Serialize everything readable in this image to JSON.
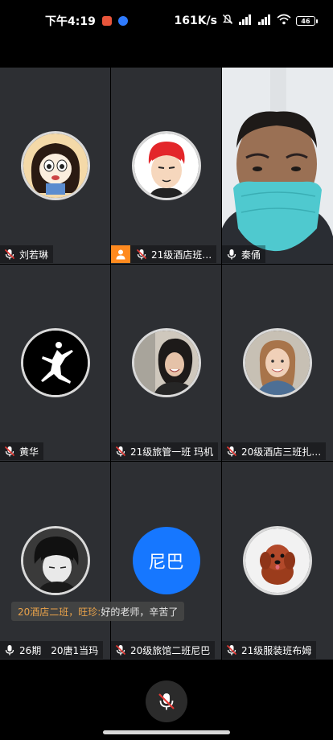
{
  "status_bar": {
    "time": "下午4:19",
    "network_speed": "161K/s",
    "battery_level": "46",
    "icons": [
      "notification-app-icon",
      "message-app-icon",
      "mute-icon",
      "signal-icon",
      "signal-icon",
      "wifi-icon",
      "battery-icon"
    ]
  },
  "participants": [
    {
      "name": "刘若琳",
      "mic": "muted",
      "avatar": "cartoon-girl"
    },
    {
      "name": "21级酒店班…",
      "mic": "muted",
      "avatar": "red-hair-anime",
      "host": true
    },
    {
      "name": "秦俑",
      "mic": "on",
      "video": "camera-feed",
      "active_speaker": true
    },
    {
      "name": "黄华",
      "mic": "muted",
      "avatar": "jumpman-logo"
    },
    {
      "name": "21级旅管一班 玛机",
      "mic": "muted",
      "avatar": "photo-woman-laughing"
    },
    {
      "name": "20级酒店三班扎…",
      "mic": "muted",
      "avatar": "photo-girl-smiling"
    },
    {
      "name": "26期　20唐1当玛",
      "mic": "on",
      "avatar": "anime-boy-dark"
    },
    {
      "name": "20级旅馆二班尼巴",
      "mic": "muted",
      "avatar_initials": "尼巴"
    },
    {
      "name": "21级服装班布姆",
      "mic": "muted",
      "avatar": "puppy"
    }
  ],
  "chat": {
    "sender": "20酒店二班，旺珍:",
    "message": "好的老师，辛苦了"
  },
  "controls": {
    "mic_button_state": "muted"
  },
  "colors": {
    "tile_background": "#2d2f33",
    "active_border": "#2fbf4d",
    "host_badge": "#ff8a1f",
    "initials_avatar": "#1677ff",
    "chat_sender": "#e9a24a"
  }
}
